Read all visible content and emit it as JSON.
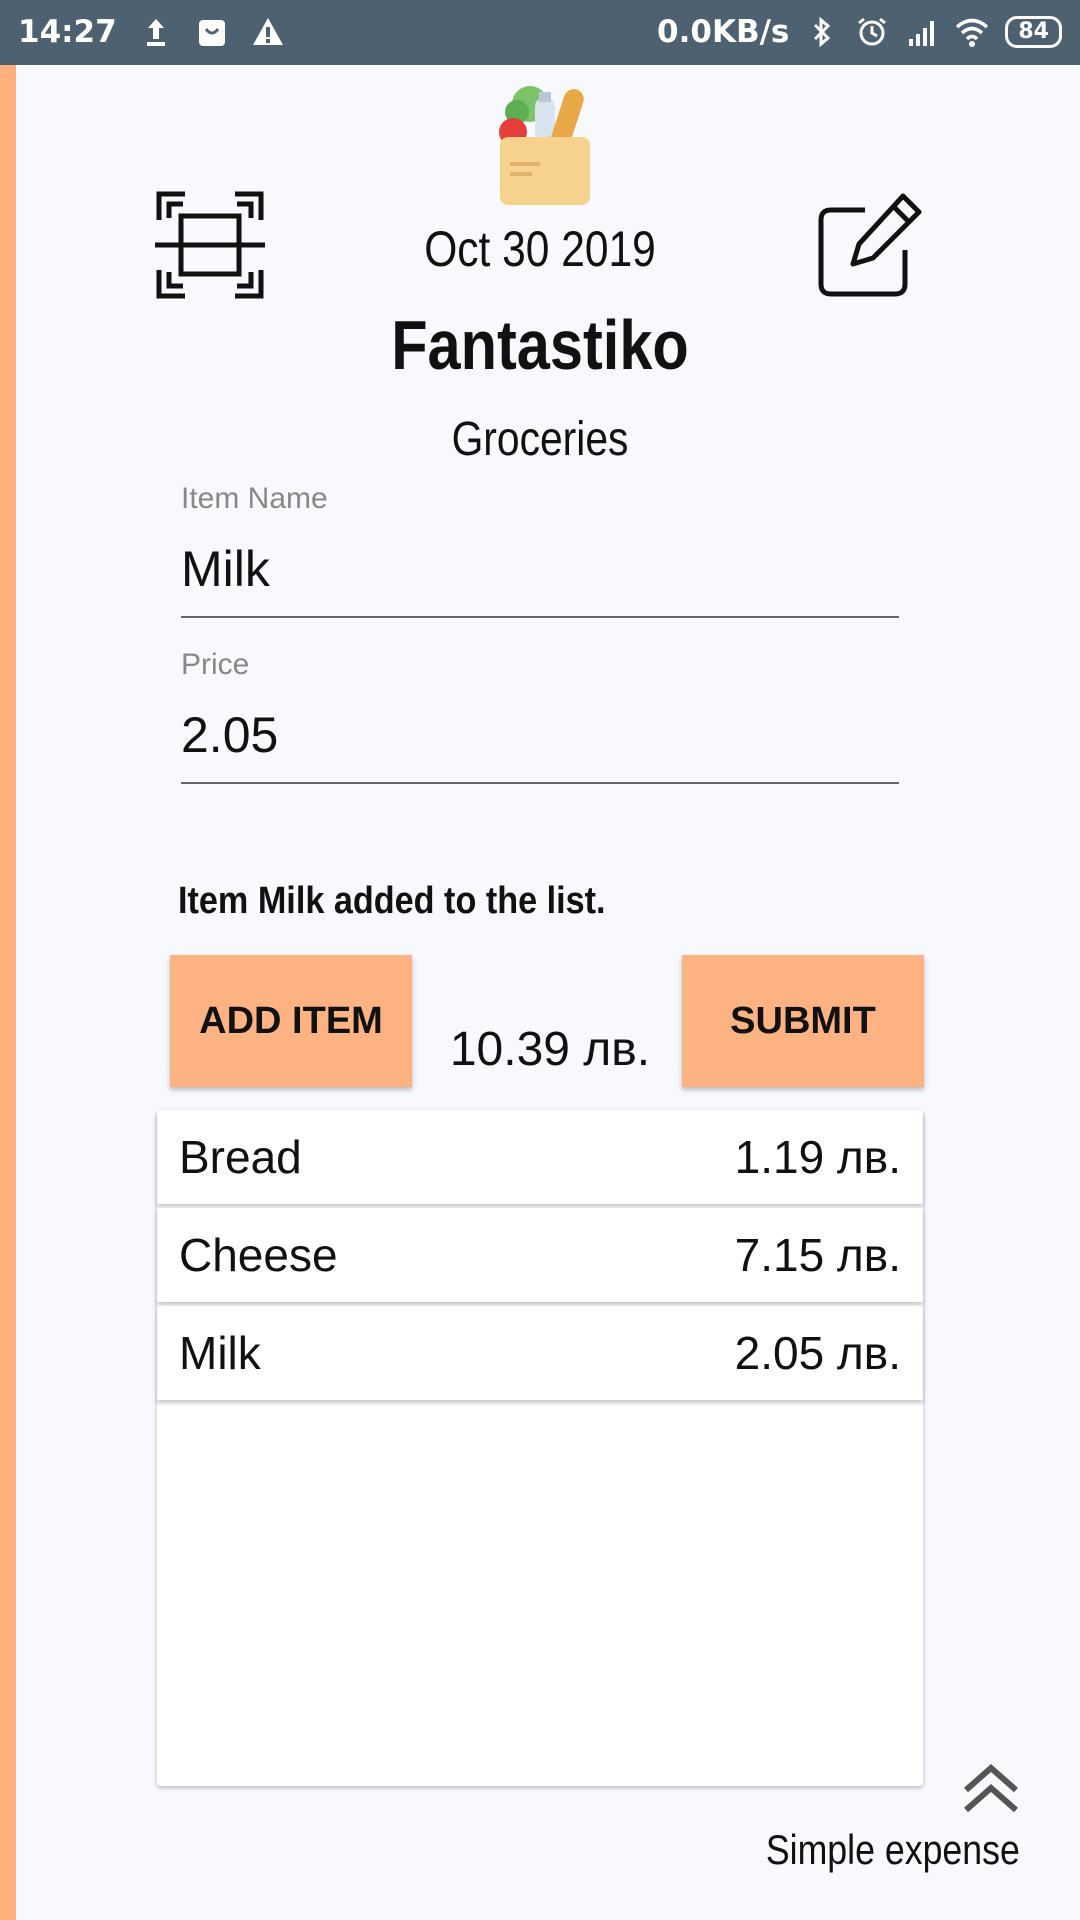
{
  "status_bar": {
    "time": "14:27",
    "net_speed": "0.0KB/s",
    "battery": "84",
    "icons": [
      "upload-icon",
      "bag-icon",
      "warning-icon",
      "bluetooth-icon",
      "alarm-icon",
      "signal-icon",
      "wifi-icon",
      "battery-icon"
    ]
  },
  "header": {
    "date": "Oct 30 2019",
    "store": "Fantastiko",
    "category": "Groceries",
    "logo_icon": "grocery-bag-icon",
    "left_icon": "scan-icon",
    "right_icon": "edit-icon"
  },
  "form": {
    "item_name_label": "Item Name",
    "item_name_value": "Milk",
    "price_label": "Price",
    "price_value": "2.05"
  },
  "message": "Item Milk added to the list.",
  "buttons": {
    "add_item": "ADD ITEM",
    "submit": "SUBMIT"
  },
  "total": "10.39 лв.",
  "items": [
    {
      "name": "Bread",
      "price": "1.19 лв."
    },
    {
      "name": "Cheese",
      "price": "7.15 лв."
    },
    {
      "name": "Milk",
      "price": "2.05 лв."
    }
  ],
  "footer": {
    "label": "Simple expense",
    "scroll_icon": "double-chevron-up-icon"
  },
  "colors": {
    "status_bar": "#4d6170",
    "accent": "#ffb282",
    "background": "#f8f9fc"
  }
}
